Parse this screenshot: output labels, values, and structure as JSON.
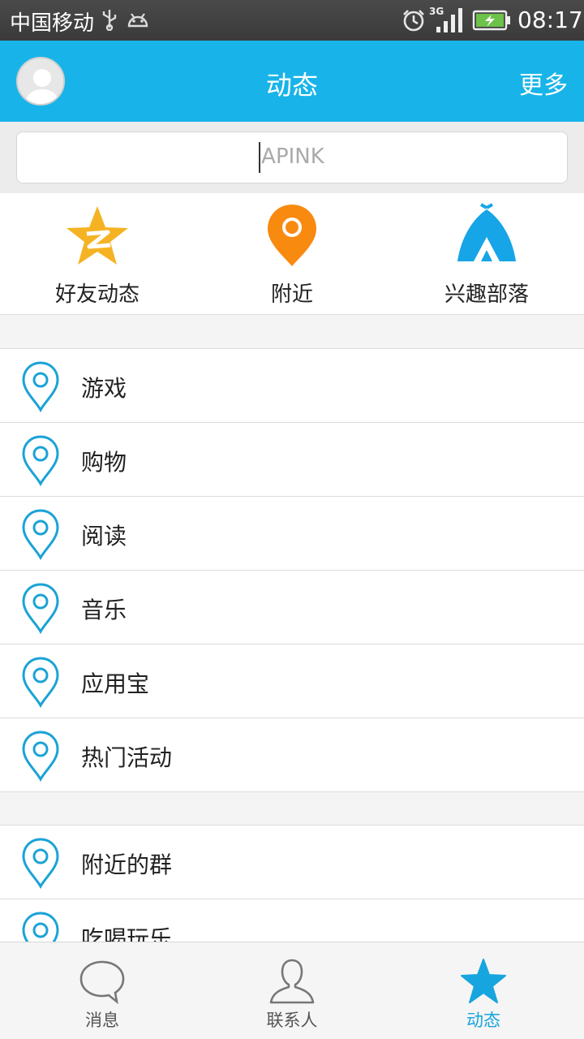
{
  "status_bar": {
    "carrier": "中国移动",
    "network": "3G",
    "time": "08:17"
  },
  "header": {
    "title": "动态",
    "more": "更多"
  },
  "search": {
    "value": "APINK"
  },
  "shortcuts": [
    {
      "label": "好友动态",
      "icon": "qzone-star-icon",
      "color": "#f5b324"
    },
    {
      "label": "附近",
      "icon": "location-pin-icon",
      "color": "#f98a10"
    },
    {
      "label": "兴趣部落",
      "icon": "tent-icon",
      "color": "#16a5e6"
    }
  ],
  "list_group_1": [
    {
      "label": "游戏"
    },
    {
      "label": "购物"
    },
    {
      "label": "阅读"
    },
    {
      "label": "音乐"
    },
    {
      "label": "应用宝"
    },
    {
      "label": "热门活动"
    }
  ],
  "list_group_2": [
    {
      "label": "附近的群"
    },
    {
      "label": "吃喝玩乐"
    }
  ],
  "bottom_nav": [
    {
      "label": "消息",
      "icon": "chat-bubble-icon"
    },
    {
      "label": "联系人",
      "icon": "person-icon"
    },
    {
      "label": "动态",
      "icon": "star-icon",
      "active": true
    }
  ],
  "colors": {
    "accent": "#18b4e9",
    "pin": "#1ba3d6"
  }
}
